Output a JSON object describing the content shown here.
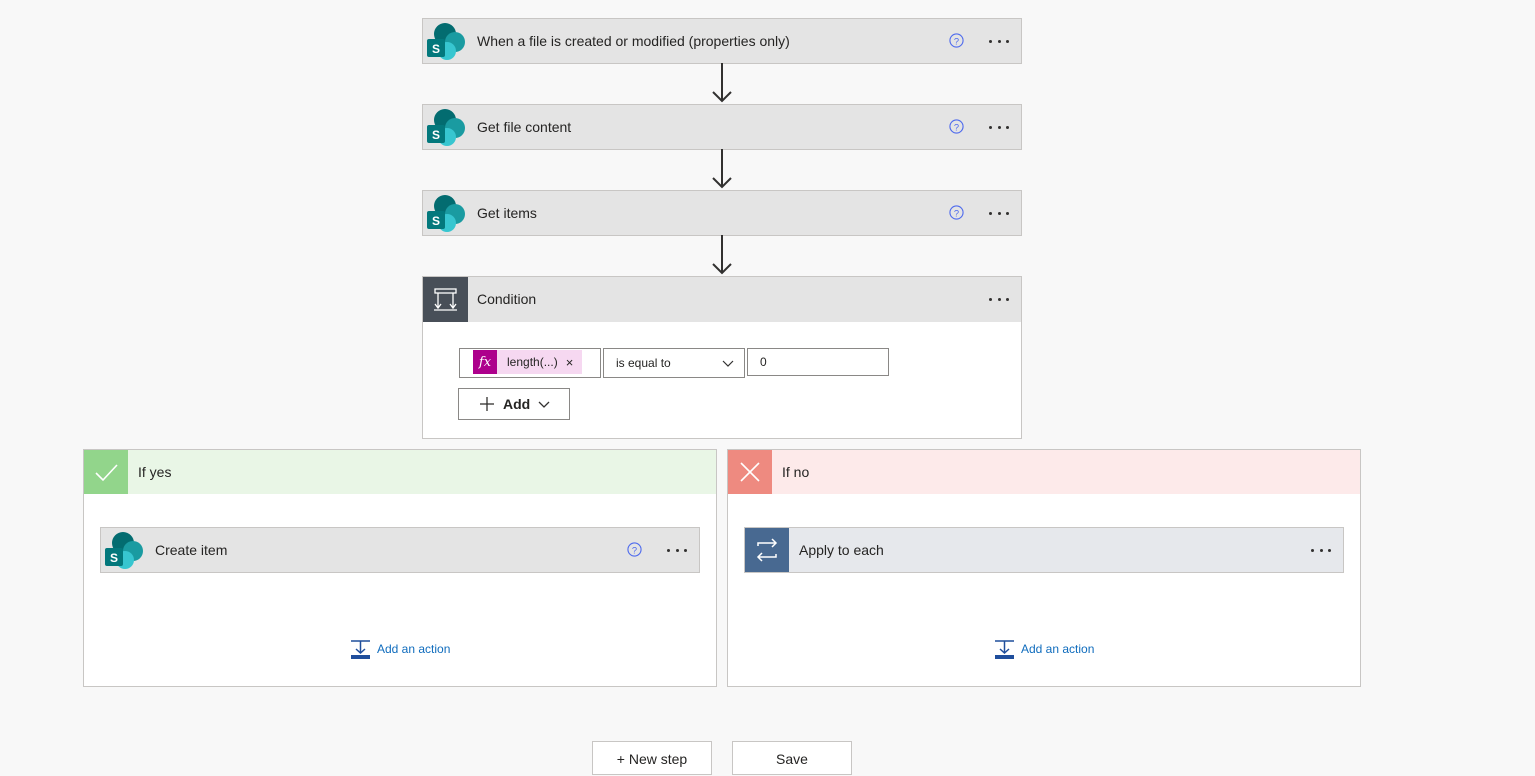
{
  "steps": [
    {
      "title": "When a file is created or modified (properties only)",
      "icon": "sharepoint-icon"
    },
    {
      "title": "Get file content",
      "icon": "sharepoint-icon"
    },
    {
      "title": "Get items",
      "icon": "sharepoint-icon"
    }
  ],
  "condition": {
    "title": "Condition",
    "icon": "condition-icon",
    "token_label": "length(...)",
    "token_remove": "×",
    "operator": "is equal to",
    "value": "0",
    "add_label": "Add"
  },
  "branches": {
    "yes": {
      "title": "If yes",
      "header_color": "#e9f6e6",
      "icon_color": "#92d58b",
      "action": {
        "title": "Create item",
        "icon": "sharepoint-icon"
      },
      "add_action_label": "Add an action"
    },
    "no": {
      "title": "If no",
      "header_color": "#fdeaea",
      "icon_color": "#ee8a80",
      "action": {
        "title": "Apply to each",
        "icon": "loop-icon",
        "icon_color": "#486991"
      },
      "add_action_label": "Add an action"
    }
  },
  "footer": {
    "new_step_label": "+ New step",
    "save_label": "Save"
  }
}
